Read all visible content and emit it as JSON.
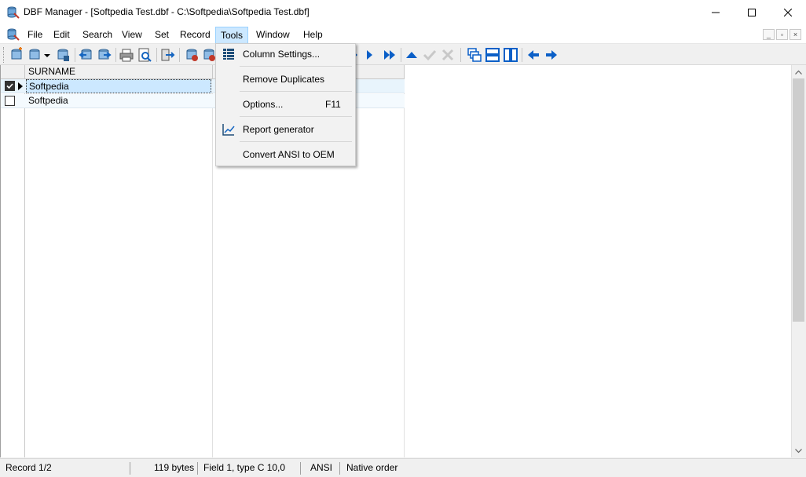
{
  "window": {
    "title": "DBF Manager - [Softpedia Test.dbf - C:\\Softpedia\\Softpedia Test.dbf]",
    "minimize_glyph": "—",
    "maximize_glyph": "☐",
    "close_glyph": "✕"
  },
  "menu": {
    "items": [
      "File",
      "Edit",
      "Search",
      "View",
      "Set",
      "Record",
      "Tools",
      "Window",
      "Help"
    ],
    "active": "Tools"
  },
  "mdi_controls": {
    "minimize": "_",
    "restore": "▫",
    "close": "×"
  },
  "tools_menu": {
    "items": [
      {
        "label": "Column Settings...",
        "icon": "column-grid-icon",
        "shortcut": ""
      },
      {
        "label": "Remove Duplicates",
        "icon": "",
        "shortcut": ""
      },
      {
        "label": "Options...",
        "icon": "",
        "shortcut": "F11"
      },
      {
        "label": "Report generator",
        "icon": "report-chart-icon",
        "shortcut": ""
      },
      {
        "label": "Convert ANSI to OEM",
        "icon": "",
        "shortcut": ""
      }
    ]
  },
  "grid": {
    "columns": [
      "SURNAME"
    ],
    "rows": [
      {
        "checked": true,
        "current": true,
        "surname": "Softpedia"
      },
      {
        "checked": false,
        "current": false,
        "surname": "Softpedia"
      }
    ]
  },
  "statusbar": {
    "record": "Record 1/2",
    "size": "119 bytes",
    "field": "Field 1, type C 10,0",
    "encoding": "ANSI",
    "order": "Native order"
  },
  "colors": {
    "accent_blue": "#0b5fc7",
    "selection_bg": "#cce8ff",
    "row_highlight": "#e8f4fc"
  }
}
